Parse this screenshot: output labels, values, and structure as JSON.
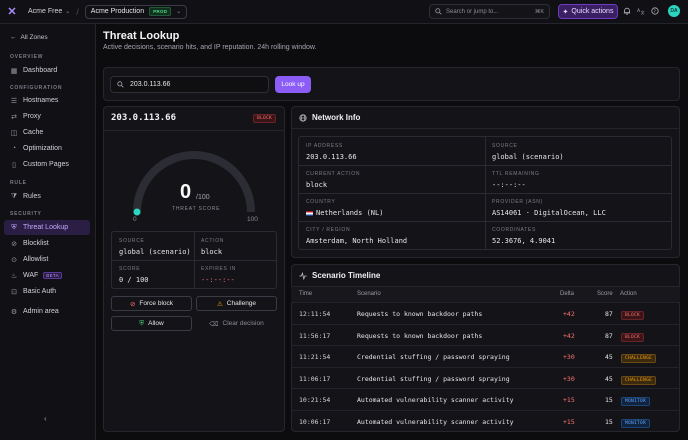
{
  "topbar": {
    "logo": "✕",
    "org": "Acme Free",
    "zone": "Acme Production",
    "zone_badge": "PROD",
    "search_placeholder": "Search or jump to...",
    "search_kbd": "⌘K",
    "quick_actions": "Quick actions",
    "avatar": "DA"
  },
  "sidebar": {
    "back": "All Zones",
    "sections": {
      "overview": "OVERVIEW",
      "configuration": "CONFIGURATION",
      "rule": "RULE",
      "security": "SECURITY"
    },
    "items": {
      "dashboard": "Dashboard",
      "hostnames": "Hostnames",
      "proxy": "Proxy",
      "cache": "Cache",
      "optimization": "Optimization",
      "custom_pages": "Custom Pages",
      "rules": "Rules",
      "threat_lookup": "Threat Lookup",
      "blocklist": "Blocklist",
      "allowlist": "Allowlist",
      "waf": "WAF",
      "waf_badge": "BETA",
      "basic_auth": "Basic Auth",
      "admin_area": "Admin area"
    }
  },
  "page": {
    "title": "Threat Lookup",
    "subtitle": "Active decisions, scenario hits, and IP reputation. 24h rolling window."
  },
  "lookup": {
    "value": "203.0.113.66",
    "button": "Look up"
  },
  "ip_card": {
    "ip": "203.0.113.66",
    "status": "BLOCK",
    "score": "0",
    "score_max": "/100",
    "score_label": "THREAT SCORE",
    "score_fraction": 0,
    "gauge_min": "0",
    "gauge_max": "100",
    "source_label": "SOURCE",
    "source_value": "global (scenario)",
    "action_label": "ACTION",
    "action_value": "block",
    "score_field_label": "SCORE",
    "score_field_value": "0 / 100",
    "expires_label": "EXPIRES IN",
    "expires_value": "--:--:--",
    "force_block": "Force block",
    "challenge": "Challenge",
    "allow": "Allow",
    "clear": "Clear decision"
  },
  "network": {
    "title": "Network Info",
    "ip_label": "IP ADDRESS",
    "ip_value": "203.0.113.66",
    "source_label": "SOURCE",
    "source_value": "global (scenario)",
    "action_label": "CURRENT ACTION",
    "action_value": "block",
    "ttl_label": "TTL REMAINING",
    "ttl_value": "--:--:--",
    "country_label": "COUNTRY",
    "country_value": "Netherlands (NL)",
    "provider_label": "PROVIDER (ASN)",
    "provider_value": "AS14061 · DigitalOcean, LLC",
    "city_label": "CITY / REGION",
    "city_value": "Amsterdam, North Holland",
    "coords_label": "COORDINATES",
    "coords_value": "52.3676, 4.9041"
  },
  "timeline": {
    "title": "Scenario Timeline",
    "headers": {
      "time": "Time",
      "scenario": "Scenario",
      "delta": "Delta",
      "score": "Score",
      "action": "Action"
    },
    "rows": [
      {
        "time": "12:11:54",
        "scenario": "Requests to known backdoor paths",
        "delta": "+42",
        "score": "87",
        "action": "BLOCK"
      },
      {
        "time": "11:56:17",
        "scenario": "Requests to known backdoor paths",
        "delta": "+42",
        "score": "87",
        "action": "BLOCK"
      },
      {
        "time": "11:21:54",
        "scenario": "Credential stuffing / password spraying",
        "delta": "+30",
        "score": "45",
        "action": "CHALLENGE"
      },
      {
        "time": "11:06:17",
        "scenario": "Credential stuffing / password spraying",
        "delta": "+30",
        "score": "45",
        "action": "CHALLENGE"
      },
      {
        "time": "10:21:54",
        "scenario": "Automated vulnerability scanner activity",
        "delta": "+15",
        "score": "15",
        "action": "MONITOR"
      },
      {
        "time": "10:06:17",
        "scenario": "Automated vulnerability scanner activity",
        "delta": "+15",
        "score": "15",
        "action": "MONITOR"
      }
    ]
  },
  "colors": {
    "accent": "#8b5cf6",
    "block": "#f87171",
    "challenge": "#f59e0b",
    "monitor": "#60a5fa",
    "gauge_dot": "#2dd4bf",
    "delta": "#f87171"
  }
}
